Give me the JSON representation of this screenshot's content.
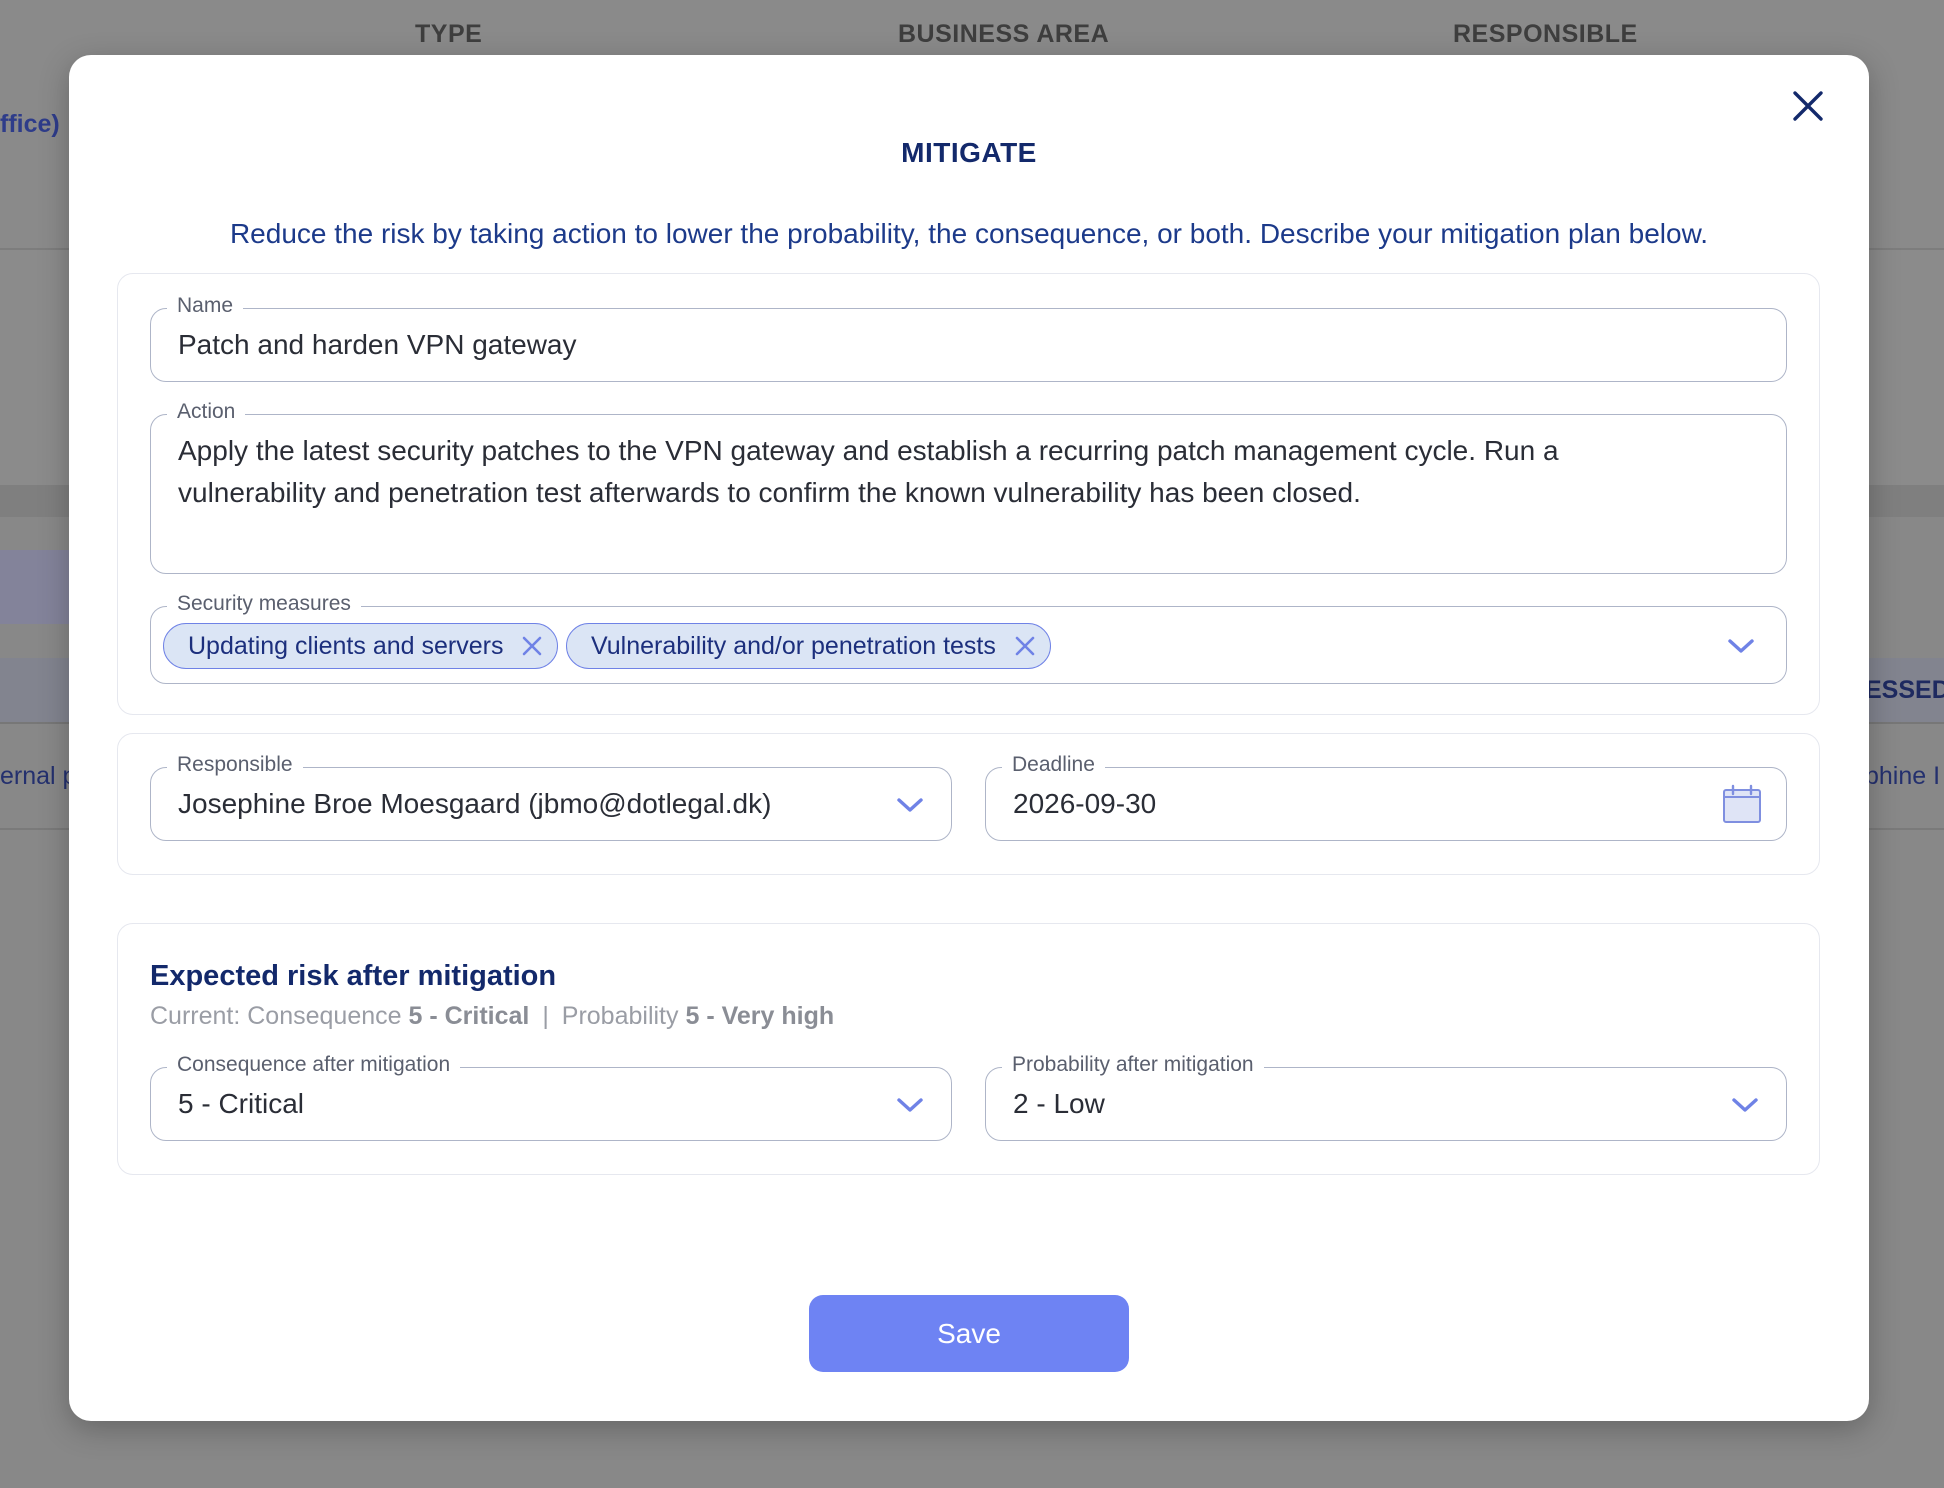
{
  "background": {
    "columns": [
      "TYPE",
      "BUSINESS AREA",
      "RESPONSIBLE"
    ],
    "link_fragment": "ffice)",
    "assessed_fragment": "ESSED",
    "row_left_fragment": "ernal p",
    "row_right_fragment": "phine I"
  },
  "modal": {
    "title": "MITIGATE",
    "description": "Reduce the risk by taking action to lower the probability, the consequence, or both. Describe your mitigation plan below.",
    "name": {
      "label": "Name",
      "value": "Patch and harden VPN gateway"
    },
    "action": {
      "label": "Action",
      "line1": "Apply the latest security patches to the VPN gateway and establish a recurring patch management cycle. Run a",
      "line2": "vulnerability and penetration test afterwards to confirm the known vulnerability has been closed."
    },
    "security_measures": {
      "label": "Security measures",
      "chips": [
        "Updating clients and servers",
        "Vulnerability and/or penetration tests"
      ]
    },
    "responsible": {
      "label": "Responsible",
      "value": "Josephine Broe Moesgaard (jbmo@dotlegal.dk)"
    },
    "deadline": {
      "label": "Deadline",
      "value": "2026-09-30"
    },
    "expected_risk": {
      "title": "Expected risk after mitigation",
      "current_prefix": "Current: Consequence",
      "current_consequence": "5 - Critical",
      "separator": "|",
      "probability_prefix": "Probability",
      "current_probability": "5 - Very high",
      "consequence_after": {
        "label": "Consequence after mitigation",
        "value": "5 - Critical"
      },
      "probability_after": {
        "label": "Probability after mitigation",
        "value": "2 - Low"
      }
    },
    "save_label": "Save"
  },
  "colors": {
    "primary": "#6e83f3",
    "title": "#13296b",
    "chip_bg": "#dbe5f5",
    "overlay": "#888888"
  }
}
